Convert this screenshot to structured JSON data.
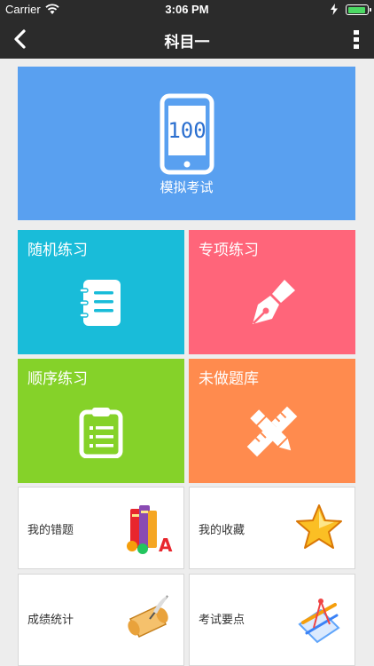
{
  "status": {
    "carrier": "Carrier",
    "time": "3:06 PM",
    "battery_level": 0.95
  },
  "nav": {
    "title": "科目一"
  },
  "tiles": {
    "mock_exam": {
      "label": "模拟考试",
      "phone_text": "100"
    },
    "random": {
      "label": "随机练习",
      "color": "#19bcd9"
    },
    "topic": {
      "label": "专项练习",
      "color": "#ff657a"
    },
    "order": {
      "label": "顺序练习",
      "color": "#85d229"
    },
    "undone": {
      "label": "未做题库",
      "color": "#ff8b4e"
    }
  },
  "items": {
    "wrong": {
      "label": "我的错题"
    },
    "favorites": {
      "label": "我的收藏"
    },
    "scores": {
      "label": "成绩统计"
    },
    "key_points": {
      "label": "考试要点"
    }
  }
}
